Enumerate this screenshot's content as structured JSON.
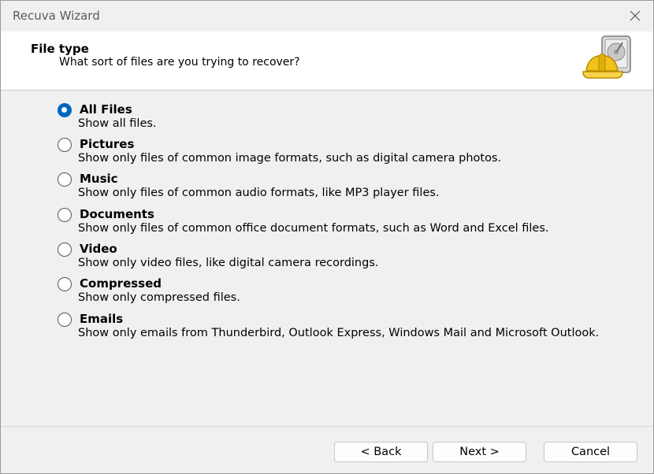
{
  "window": {
    "title": "Recuva Wizard"
  },
  "header": {
    "title": "File type",
    "subtitle": "What sort of files are you trying to recover?"
  },
  "options": [
    {
      "label": "All Files",
      "description": "Show all files.",
      "selected": true
    },
    {
      "label": "Pictures",
      "description": "Show only files of common image formats, such as digital camera photos.",
      "selected": false
    },
    {
      "label": "Music",
      "description": "Show only files of common audio formats, like MP3 player files.",
      "selected": false
    },
    {
      "label": "Documents",
      "description": "Show only files of common office document formats, such as Word and Excel files.",
      "selected": false
    },
    {
      "label": "Video",
      "description": "Show only video files, like digital camera recordings.",
      "selected": false
    },
    {
      "label": "Compressed",
      "description": "Show only compressed files.",
      "selected": false
    },
    {
      "label": "Emails",
      "description": "Show only emails from Thunderbird, Outlook Express, Windows Mail and Microsoft Outlook.",
      "selected": false
    }
  ],
  "buttons": {
    "back": "< Back",
    "next": "Next >",
    "cancel": "Cancel"
  },
  "colors": {
    "accent": "#0067c0",
    "header_bg": "#ffffff",
    "body_bg": "#f0f0f0"
  },
  "icons": {
    "logo": "recuva-hard-hat-drive-icon",
    "close": "close-icon"
  }
}
